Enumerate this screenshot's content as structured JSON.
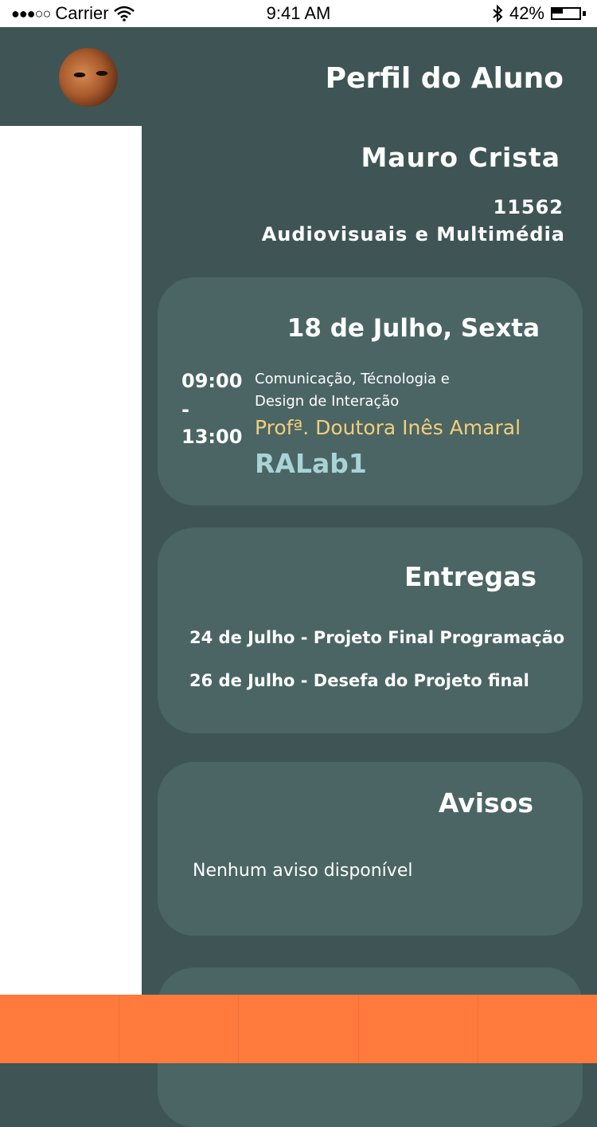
{
  "status_bar": {
    "carrier": "Carrier",
    "signal_dots": "●●●○○",
    "time": "9:41 AM",
    "battery": "42%",
    "battery_level": 0.42
  },
  "header": {
    "title": "Perfil do Aluno"
  },
  "student": {
    "name": "Mauro Crista",
    "number": "11562",
    "course": "Audiovisuais e Multimédia"
  },
  "schedule": {
    "date": "18 de Julho, Sexta",
    "time_start": "09:00",
    "time_separator": "-",
    "time_end": "13:00",
    "course": "Comunicação, Técnologia e Design de Interação",
    "professor": "Profª. Doutora Inês Amaral",
    "room": "RALab1"
  },
  "deliveries": {
    "heading": "Entregas",
    "items": [
      "24 de Julho - Projeto Final Programação",
      "26 de Julho - Desefa do Projeto final"
    ]
  },
  "notices": {
    "heading": "Avisos",
    "empty_text": "Nenhum aviso disponível"
  },
  "colors": {
    "background": "#3f5555",
    "card": "#4a6564",
    "professor": "#f3ce7c",
    "room": "#a9d3d6",
    "tab_bar": "#ff7a3c"
  },
  "tab_bar": {
    "tabs": [
      "",
      "",
      "",
      "",
      ""
    ]
  }
}
